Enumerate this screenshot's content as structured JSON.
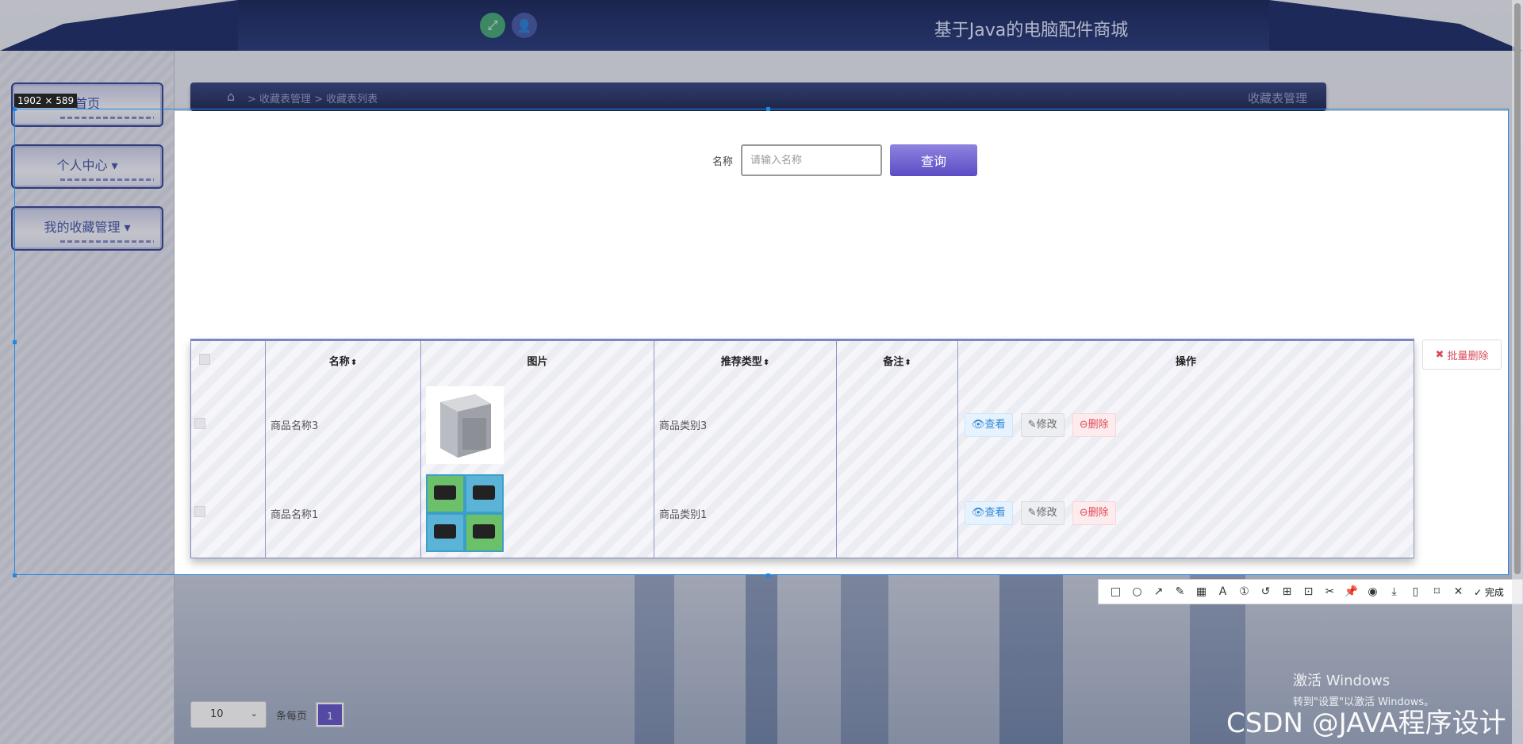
{
  "header": {
    "title": "基于Java的电脑配件商城",
    "fullscreen_icon": "expand-icon",
    "user_icon": "user-icon"
  },
  "sidebar": {
    "items": [
      {
        "label": "首页"
      },
      {
        "label": "个人中心 ▾"
      },
      {
        "label": "我的收藏管理 ▾"
      }
    ]
  },
  "breadcrumb": {
    "path": "> 收藏表管理 > 收藏表列表",
    "right_title": "收藏表管理"
  },
  "search": {
    "label": "名称",
    "placeholder": "请输入名称",
    "button": "查询"
  },
  "table": {
    "columns": [
      "名称",
      "图片",
      "推荐类型",
      "备注",
      "操作"
    ],
    "sortable_marker": "⬍",
    "rows": [
      {
        "name": "商品名称3",
        "type": "商品类别3",
        "note": ""
      },
      {
        "name": "商品名称1",
        "type": "商品类别1",
        "note": ""
      }
    ],
    "actions": {
      "view": "查看",
      "edit": "修改",
      "delete": "删除"
    }
  },
  "batch_delete": "批量删除",
  "pagination": {
    "page_size": "10",
    "per_page_label": "条每页",
    "current_page": "1"
  },
  "capture": {
    "size_label": "1902 × 589",
    "done_label": "完成"
  },
  "watermark": {
    "activate_line1": "激活 Windows",
    "activate_line2": "转到\"设置\"以激活 Windows。",
    "csdn": "CSDN @JAVA程序设计"
  },
  "colors": {
    "header": "#0f1f5c",
    "accent": "#5b4cc4",
    "selection": "#1e88e5"
  }
}
